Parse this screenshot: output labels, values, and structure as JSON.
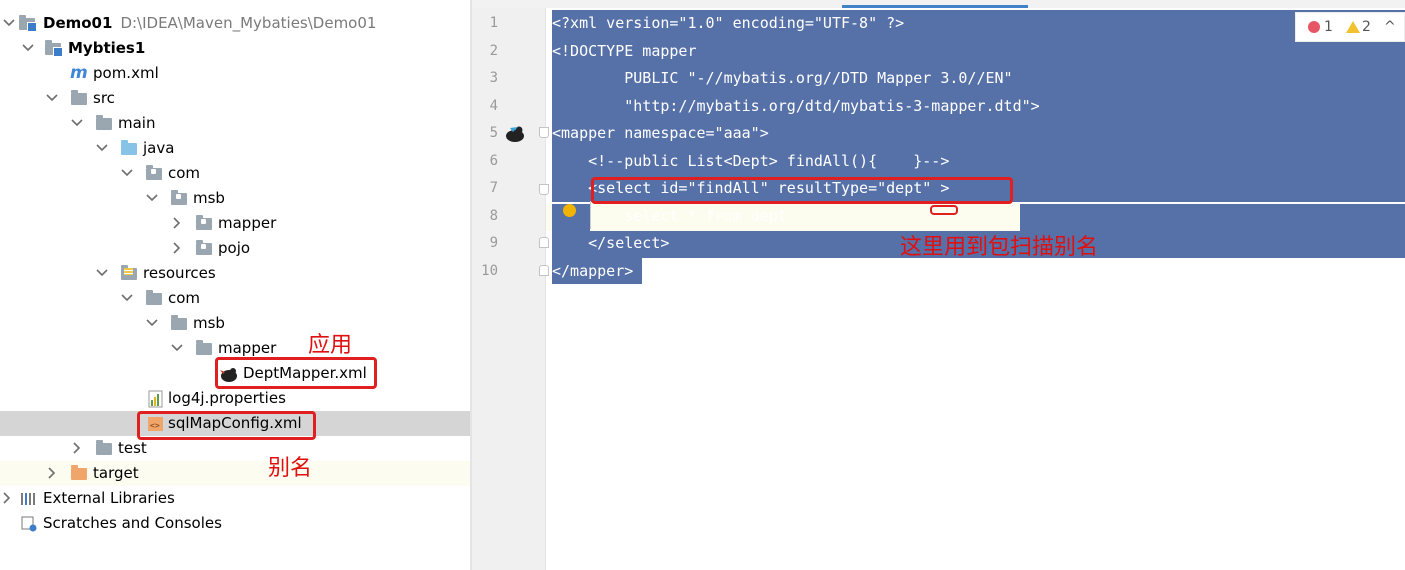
{
  "project_tree": {
    "items": [
      {
        "label": "Demo01",
        "path": "D:\\IDEA\\Maven_Mybaties\\Demo01"
      },
      {
        "label": "Mybties1"
      },
      {
        "label": "pom.xml"
      },
      {
        "label": "src"
      },
      {
        "label": "main"
      },
      {
        "label": "java"
      },
      {
        "label": "com"
      },
      {
        "label": "msb"
      },
      {
        "label": "mapper"
      },
      {
        "label": "pojo"
      },
      {
        "label": "resources"
      },
      {
        "label": "com"
      },
      {
        "label": "msb"
      },
      {
        "label": "mapper"
      },
      {
        "label": "DeptMapper.xml"
      },
      {
        "label": "log4j.properties"
      },
      {
        "label": "sqlMapConfig.xml"
      },
      {
        "label": "test"
      },
      {
        "label": "target"
      },
      {
        "label": "External Libraries"
      },
      {
        "label": "Scratches and Consoles"
      }
    ],
    "selected_item": "sqlMapConfig.xml"
  },
  "annotations": {
    "apply": "应用",
    "alias": "别名",
    "package_scan_alias": "这里用到包扫描别名"
  },
  "editor": {
    "line_numbers": [
      "1",
      "2",
      "3",
      "4",
      "5",
      "6",
      "7",
      "8",
      "9",
      "10"
    ],
    "lines": [
      "<?xml version=\"1.0\" encoding=\"UTF-8\" ?>",
      "<!DOCTYPE mapper",
      "        PUBLIC \"-//mybatis.org//DTD Mapper 3.0//EN\"",
      "        \"http://mybatis.org/dtd/mybatis-3-mapper.dtd\">",
      "<mapper namespace=\"aaa\">",
      "    <!--public List<Dept> findAll(){    }-->",
      "    <select id=\"findAll\" resultType=\"dept\" >",
      "        select * from dept",
      "    </select>",
      "</mapper>"
    ],
    "inspections": {
      "errors": "1",
      "warnings": "2"
    }
  },
  "colors": {
    "selection": "#5670a8",
    "annotation_red": "#e02020",
    "tree_selected": "#d5d5d5"
  }
}
